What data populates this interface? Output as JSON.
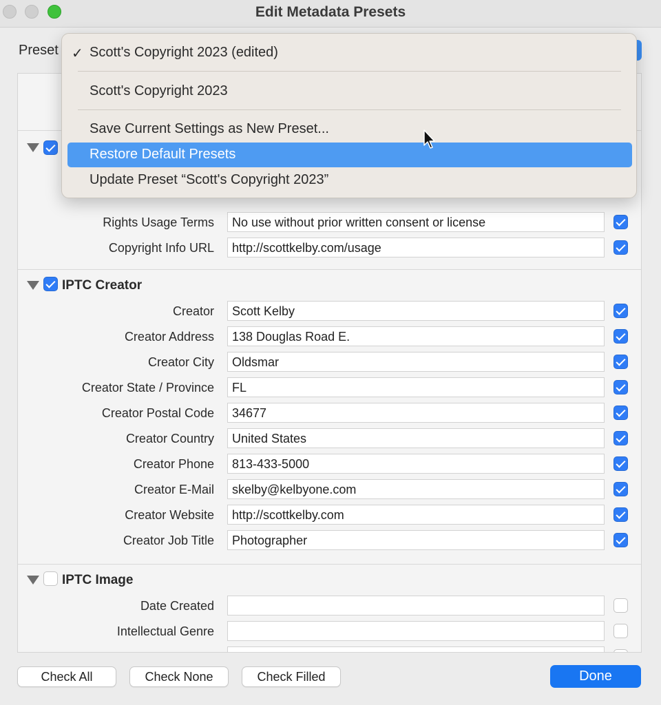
{
  "window": {
    "title": "Edit Metadata Presets"
  },
  "preset": {
    "label": "Preset"
  },
  "menu": {
    "items": [
      {
        "label": "Scott's Copyright 2023 (edited)",
        "checked": true,
        "check_glyph": "✓"
      },
      {
        "label": "Scott's Copyright 2023"
      },
      {
        "label": "Save Current Settings as New Preset..."
      },
      {
        "label": "Restore Default Presets",
        "highlighted": true
      },
      {
        "label": "Update Preset “Scott's Copyright 2023”"
      }
    ]
  },
  "copyright_rows": [
    {
      "label": "Rights Usage Terms",
      "value": "No use without prior written consent or license",
      "checked": true
    },
    {
      "label": "Copyright Info URL",
      "value": "http://scottkelby.com/usage",
      "checked": true
    }
  ],
  "iptc_creator": {
    "title": "IPTC Creator",
    "checked": true,
    "rows": [
      {
        "label": "Creator",
        "value": "Scott Kelby",
        "checked": true
      },
      {
        "label": "Creator Address",
        "value": "138 Douglas Road E.",
        "checked": true
      },
      {
        "label": "Creator City",
        "value": "Oldsmar",
        "checked": true
      },
      {
        "label": "Creator State / Province",
        "value": "FL",
        "checked": true
      },
      {
        "label": "Creator Postal Code",
        "value": "34677",
        "checked": true
      },
      {
        "label": "Creator Country",
        "value": "United States",
        "checked": true
      },
      {
        "label": "Creator Phone",
        "value": "813-433-5000",
        "checked": true
      },
      {
        "label": "Creator E-Mail",
        "value": "skelby@kelbyone.com",
        "checked": true
      },
      {
        "label": "Creator Website",
        "value": "http://scottkelby.com",
        "checked": true
      },
      {
        "label": "Creator Job Title",
        "value": "Photographer",
        "checked": true
      }
    ]
  },
  "iptc_image": {
    "title": "IPTC Image",
    "checked": false,
    "rows": [
      {
        "label": "Date Created",
        "value": "",
        "checked": false
      },
      {
        "label": "Intellectual Genre",
        "value": "",
        "checked": false
      }
    ]
  },
  "buttons": {
    "check_all": "Check All",
    "check_none": "Check None",
    "check_filled": "Check Filled",
    "done": "Done"
  },
  "colors": {
    "accent": "#1976f2",
    "menu_highlight": "#4e9bf2",
    "checkbox_on": "#2f7cf6"
  }
}
